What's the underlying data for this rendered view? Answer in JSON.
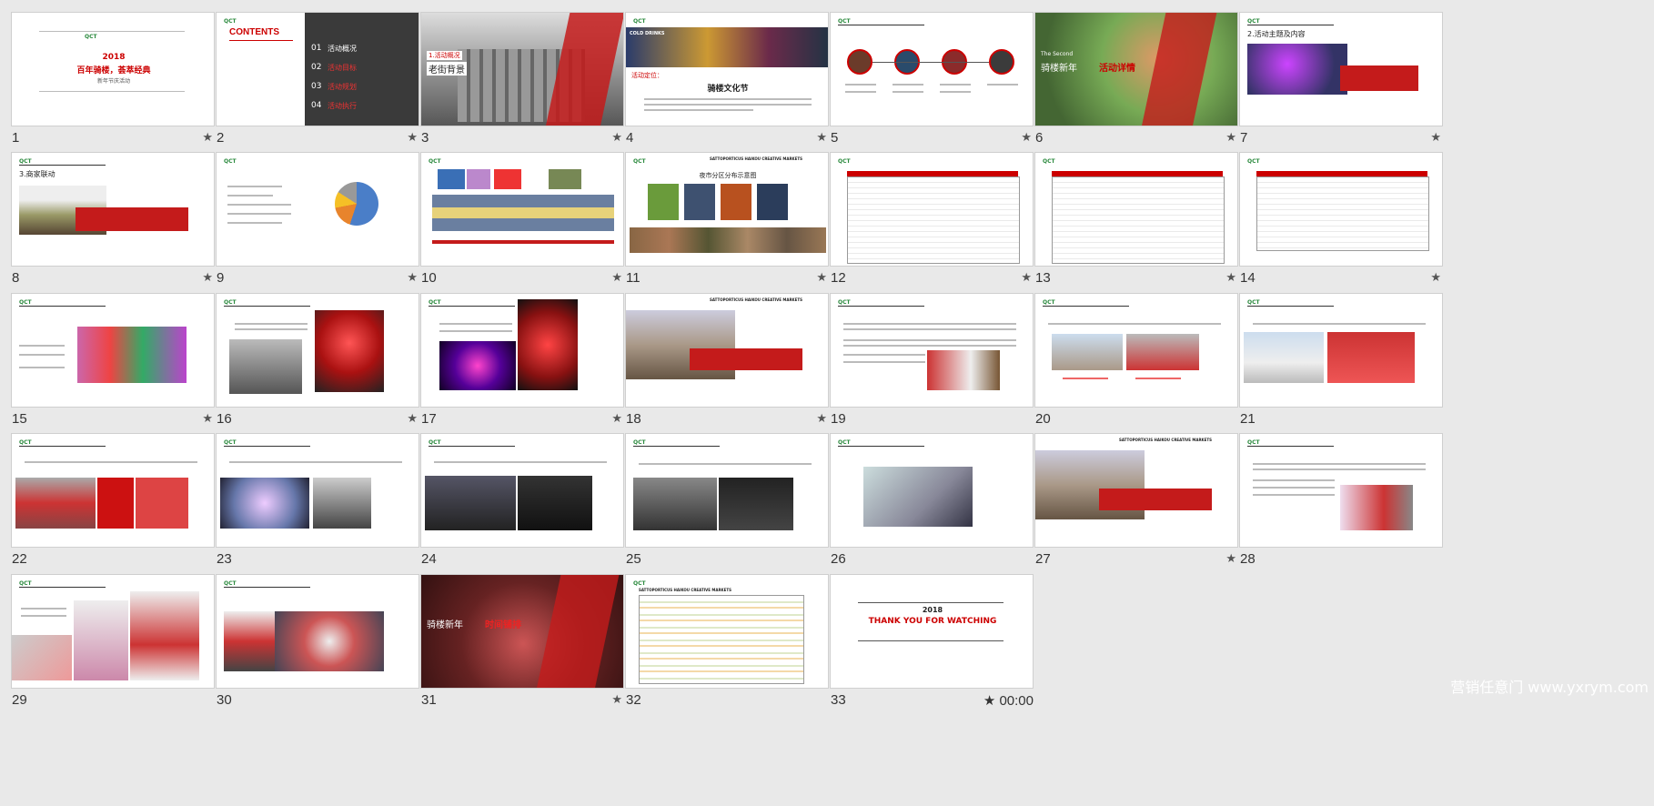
{
  "slides": [
    {
      "number": "1",
      "starred": true,
      "texts": [
        "QCT",
        "2018",
        "百年骑楼，荟萃经典",
        "新年节庆活动"
      ]
    },
    {
      "number": "2",
      "starred": true,
      "texts": [
        "CONTENTS",
        "01",
        "活动概况",
        "02",
        "活动目标",
        "03",
        "活动规划",
        "04",
        "活动执行"
      ]
    },
    {
      "number": "3",
      "starred": true,
      "texts": [
        "1.活动概况",
        "老街背景"
      ]
    },
    {
      "number": "4",
      "starred": true,
      "texts": [
        "COLD DRINKS",
        "活动定位：",
        "骑楼文化节"
      ]
    },
    {
      "number": "5",
      "starred": true,
      "texts": []
    },
    {
      "number": "6",
      "starred": true,
      "texts": [
        "The Second",
        "骑楼新年",
        "活动详情"
      ]
    },
    {
      "number": "7",
      "starred": true,
      "texts": [
        "2.活动主题及内容"
      ]
    },
    {
      "number": "8",
      "starred": true,
      "texts": [
        "3.商家联动"
      ]
    },
    {
      "number": "9",
      "starred": true,
      "texts": []
    },
    {
      "number": "10",
      "starred": true,
      "texts": []
    },
    {
      "number": "11",
      "starred": true,
      "texts": [
        "SATTOPORTICUS HAIKOU CREATIVE MARKETS",
        "夜市分区分布示意图"
      ]
    },
    {
      "number": "12",
      "starred": true,
      "texts": []
    },
    {
      "number": "13",
      "starred": true,
      "texts": []
    },
    {
      "number": "14",
      "starred": true,
      "texts": []
    },
    {
      "number": "15",
      "starred": true,
      "texts": []
    },
    {
      "number": "16",
      "starred": true,
      "texts": []
    },
    {
      "number": "17",
      "starred": true,
      "texts": []
    },
    {
      "number": "18",
      "starred": true,
      "texts": [
        "SATTOPORTICUS HAIKOU CREATIVE MARKETS"
      ]
    },
    {
      "number": "19",
      "starred": false,
      "texts": []
    },
    {
      "number": "20",
      "starred": false,
      "texts": []
    },
    {
      "number": "21",
      "starred": false,
      "texts": []
    },
    {
      "number": "22",
      "starred": false,
      "texts": []
    },
    {
      "number": "23",
      "starred": false,
      "texts": []
    },
    {
      "number": "24",
      "starred": false,
      "texts": []
    },
    {
      "number": "25",
      "starred": false,
      "texts": []
    },
    {
      "number": "26",
      "starred": false,
      "texts": []
    },
    {
      "number": "27",
      "starred": true,
      "texts": [
        "SATTOPORTICUS HAIKOU CREATIVE MARKETS"
      ]
    },
    {
      "number": "28",
      "starred": false,
      "texts": []
    },
    {
      "number": "29",
      "starred": false,
      "texts": []
    },
    {
      "number": "30",
      "starred": false,
      "texts": []
    },
    {
      "number": "31",
      "starred": true,
      "texts": [
        "骑楼新年",
        "时间铺排"
      ]
    },
    {
      "number": "32",
      "starred": false,
      "texts": [
        "SATTOPORTICUS HAIKOU CREATIVE MARKETS"
      ]
    },
    {
      "number": "33",
      "starred": true,
      "texts": [
        "2018",
        "THANK YOU FOR WATCHING"
      ]
    }
  ],
  "star_symbol": "★",
  "timer": "00:00",
  "watermark": "营销任意门 www.yxrym.com",
  "colors": {
    "background": "#e9e9e9",
    "accent_red": "#c41b1b",
    "dark": "#3a3a3a"
  }
}
